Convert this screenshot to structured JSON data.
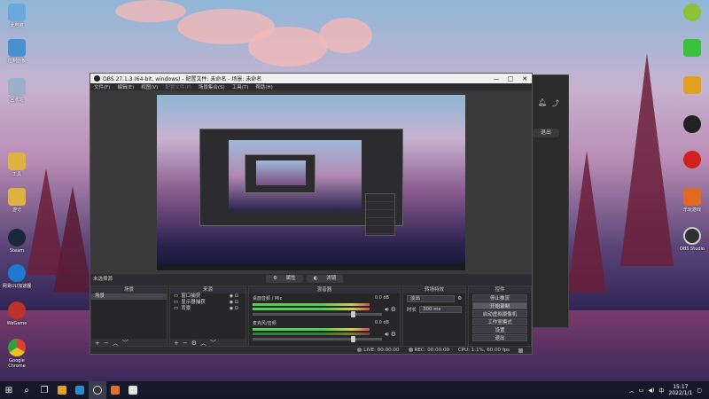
{
  "desktop": {
    "left_icons": [
      {
        "label": "此电脑",
        "icon": "computer-icon",
        "color": "#6aa9e0"
      },
      {
        "label": "控制面板",
        "icon": "control-panel-icon",
        "color": "#4a8fd0"
      },
      {
        "label": "回收站",
        "icon": "recycle-bin-icon",
        "color": "#9ab0c8"
      },
      {
        "label": "工具",
        "icon": "folder-icon",
        "color": "#e0b040"
      },
      {
        "label": "游记",
        "icon": "folder-icon",
        "color": "#e0b040"
      },
      {
        "label": "Steam",
        "icon": "steam-icon",
        "color": "#1b2838"
      },
      {
        "label": "网易UU加速器",
        "icon": "uu-booster-icon",
        "color": "#1e7ad0"
      },
      {
        "label": "WeGame",
        "icon": "wegame-icon",
        "color": "#c0302a"
      },
      {
        "label": "Google Chrome",
        "icon": "chrome-icon",
        "color": "#e04030"
      }
    ],
    "right_icons": [
      {
        "label": "",
        "icon": "app-icon",
        "color": "#8ac23a"
      },
      {
        "label": "",
        "icon": "wechat-icon",
        "color": "#3ac23a"
      },
      {
        "label": "",
        "icon": "app-icon",
        "color": "#e0a020"
      },
      {
        "label": "",
        "icon": "qq-icon",
        "color": "#222222"
      },
      {
        "label": "",
        "icon": "netease-music-icon",
        "color": "#d02020"
      },
      {
        "label": "乐玩游戏",
        "icon": "game-icon",
        "color": "#e06a20"
      },
      {
        "label": "OBS Studio",
        "icon": "obs-icon",
        "color": "#303030"
      }
    ]
  },
  "back_window": {
    "button_label": "退出"
  },
  "obs": {
    "title": "OBS 27.1.3 (64-bit, windows) - 配置文件: 未命名 - 场景: 未命名",
    "window_controls": [
      "—",
      "□",
      "✕"
    ],
    "menu": [
      "文件(F)",
      "编辑(E)",
      "视图(V)",
      "配置文件(P)",
      "场景集合(S)",
      "工具(T)",
      "帮助(H)"
    ],
    "no_source_label": "未选择源",
    "filter_buttons": [
      "属性",
      "滤镜"
    ],
    "docks": {
      "scenes": {
        "title": "场景",
        "items": [
          "场景"
        ]
      },
      "sources": {
        "title": "来源",
        "items": [
          "窗口捕获",
          "显示器捕获",
          "背景"
        ]
      },
      "mixer": {
        "title": "混音器",
        "channels": [
          {
            "name": "桌面音频 / Mic",
            "db": "0.0 dB"
          },
          {
            "name": "麦克风/音频",
            "db": "0.0 dB"
          }
        ]
      },
      "transitions": {
        "title": "转场特效",
        "type": "淡出",
        "duration_label": "时长",
        "duration_value": "300 ms"
      },
      "controls": {
        "title": "控件",
        "buttons": [
          "停止推流",
          "开始录制",
          "启动虚拟摄像机",
          "工作室模式",
          "设置",
          "退出"
        ]
      }
    },
    "status": {
      "live": "LIVE: 00:00:00",
      "rec": "REC: 00:00:00",
      "cpu": "CPU: 1.1%, 60.00 fps"
    }
  },
  "taskbar": {
    "time": "15:17",
    "date": "2022/1/1",
    "ime": "中",
    "apps": [
      "start-icon",
      "search-icon",
      "task-view-icon",
      "explorer-icon",
      "obs-icon",
      "app-icon",
      "app-icon"
    ]
  }
}
